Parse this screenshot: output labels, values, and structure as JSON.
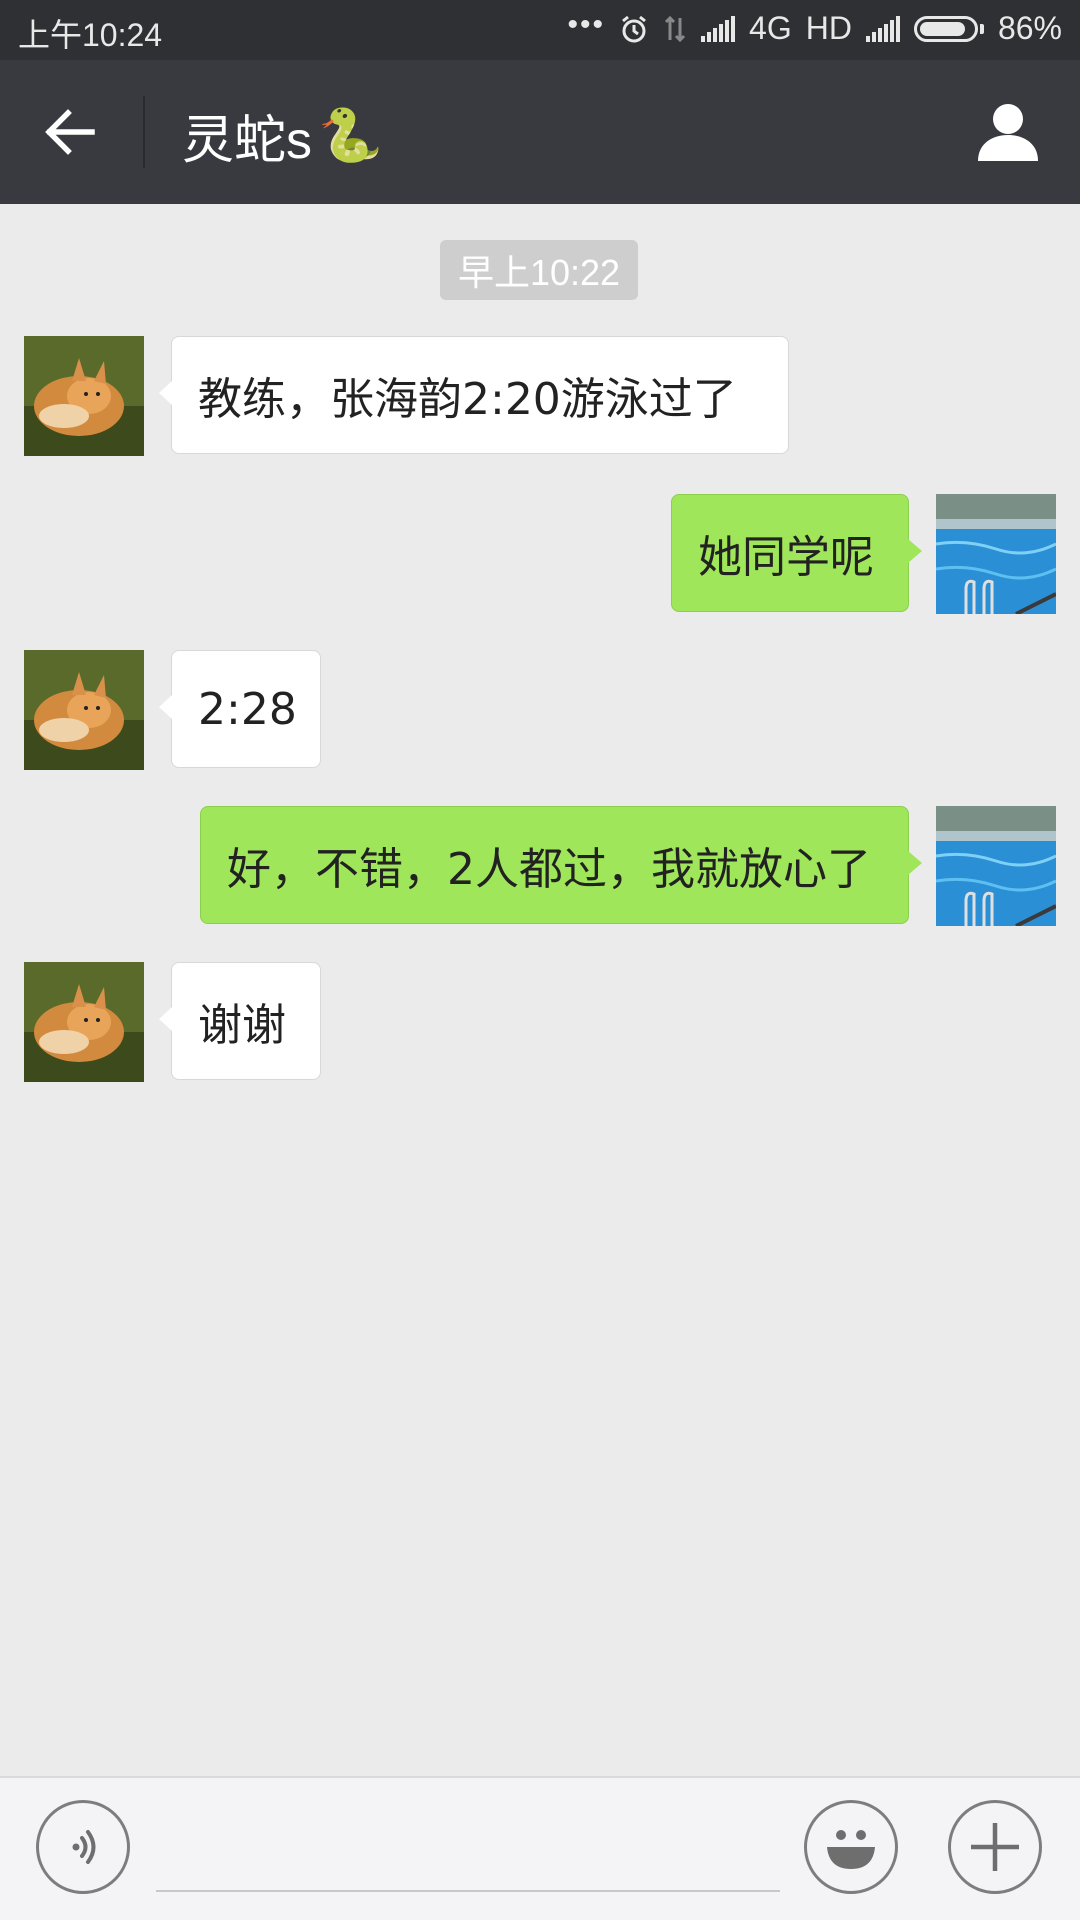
{
  "status_bar": {
    "time": "上午10:24",
    "dots": "•••",
    "network": "4G",
    "hd": "HD",
    "battery_text": "86%",
    "battery_level": 0.86
  },
  "nav": {
    "title": "灵蛇s",
    "title_emoji": "🐍"
  },
  "chat": {
    "timestamp": "早上10:22",
    "messages": [
      {
        "direction": "in",
        "text": "教练，张海韵2:20游泳过了"
      },
      {
        "direction": "out",
        "text": "她同学呢"
      },
      {
        "direction": "in",
        "text": "2:28"
      },
      {
        "direction": "out",
        "text": "好，不错，2人都过，我就放心了"
      },
      {
        "direction": "in",
        "text": "谢谢"
      }
    ]
  },
  "input": {
    "value": "",
    "placeholder": ""
  },
  "colors": {
    "status_bg": "#2f3033",
    "nav_bg": "#393a3f",
    "chat_bg": "#ebebeb",
    "bubble_out": "#9fe65a",
    "bubble_in": "#ffffff"
  },
  "icons": {
    "back": "arrow-left-icon",
    "profile": "person-icon",
    "voice": "voice-icon",
    "emoji": "smiley-icon",
    "more": "plus-icon",
    "alarm": "alarm-icon",
    "wifi_off": "data-arrows-icon",
    "signal": "signal-icon",
    "battery": "battery-icon"
  }
}
